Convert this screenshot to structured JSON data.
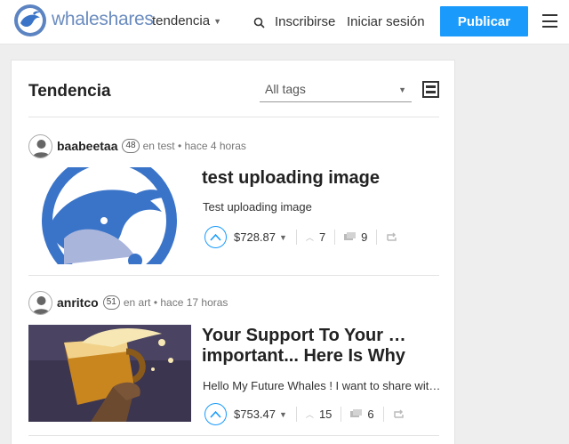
{
  "header": {
    "brand": "whaleshares",
    "sort_label": "tendencia",
    "signup_label": "Inscribirse",
    "signin_label": "Iniciar sesión",
    "publish_label": "Publicar"
  },
  "feed": {
    "title": "Tendencia",
    "tag_filter": "All tags"
  },
  "posts": [
    {
      "author": "baabeetaa",
      "reputation": "48",
      "meta": "en test • hace 4 horas",
      "title": "test uploading image",
      "body": "Test uploading image",
      "payout": "$728.87",
      "votes": "7",
      "comments": "9"
    },
    {
      "author": "anritco",
      "reputation": "51",
      "meta": "en art • hace 17 horas",
      "title": "Your Support To Your … important... Here Is Why",
      "body": "Hello My Future Whales ! I want to share wit…",
      "payout": "$753.47",
      "votes": "15",
      "comments": "6"
    }
  ],
  "colors": {
    "accent": "#1a9bfc",
    "brand": "#6b8cbf",
    "whale_blue": "#3a74c9"
  },
  "icons": [
    "whale-logo-icon",
    "search-icon",
    "hamburger-icon",
    "layout-toggle-icon",
    "chevron-up-icon",
    "comment-icon",
    "reblog-icon"
  ]
}
